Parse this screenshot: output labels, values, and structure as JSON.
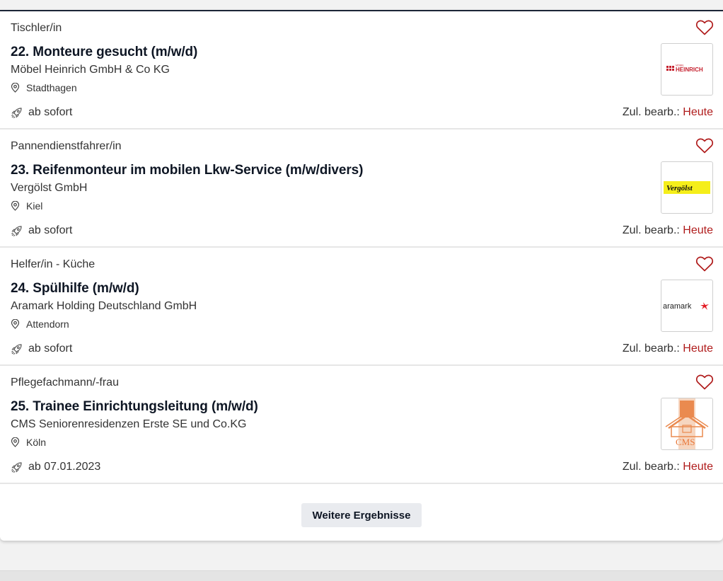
{
  "jobs": [
    {
      "category": "Tischler/in",
      "title": "22. Monteure gesucht (m/w/d)",
      "company": "Möbel Heinrich GmbH & Co KG",
      "location": "Stadthagen",
      "start": "ab sofort",
      "edited_label": "Zul. bearb.:",
      "edited_value": "Heute",
      "logo": {
        "small": "MÖBEL",
        "text": "HEINRICH"
      }
    },
    {
      "category": "Pannendienstfahrer/in",
      "title": "23. Reifenmonteur im mobilen Lkw-Service (m/w/divers)",
      "company": "Vergölst GmbH",
      "location": "Kiel",
      "start": "ab sofort",
      "edited_label": "Zul. bearb.:",
      "edited_value": "Heute",
      "logo": {
        "text": "Vergölst"
      }
    },
    {
      "category": "Helfer/in - Küche",
      "title": "24. Spülhilfe (m/w/d)",
      "company": "Aramark Holding Deutschland GmbH",
      "location": "Attendorn",
      "start": "ab sofort",
      "edited_label": "Zul. bearb.:",
      "edited_value": "Heute",
      "logo": {
        "text": "aramark"
      }
    },
    {
      "category": "Pflegefachmann/-frau",
      "title": "25. Trainee Einrichtungsleitung (m/w/d)",
      "company": "CMS Seniorenresidenzen Erste SE und Co.KG",
      "location": "Köln",
      "start": "ab 07.01.2023",
      "edited_label": "Zul. bearb.:",
      "edited_value": "Heute",
      "logo": {
        "text": "CMS"
      }
    }
  ],
  "more_button": "Weitere Ergebnisse",
  "colors": {
    "accent": "#b01c1c",
    "title": "#0e1624",
    "border": "#1c2536"
  },
  "icons": {
    "favorite": "heart-icon",
    "location": "map-pin-icon",
    "start": "rocket-icon"
  }
}
